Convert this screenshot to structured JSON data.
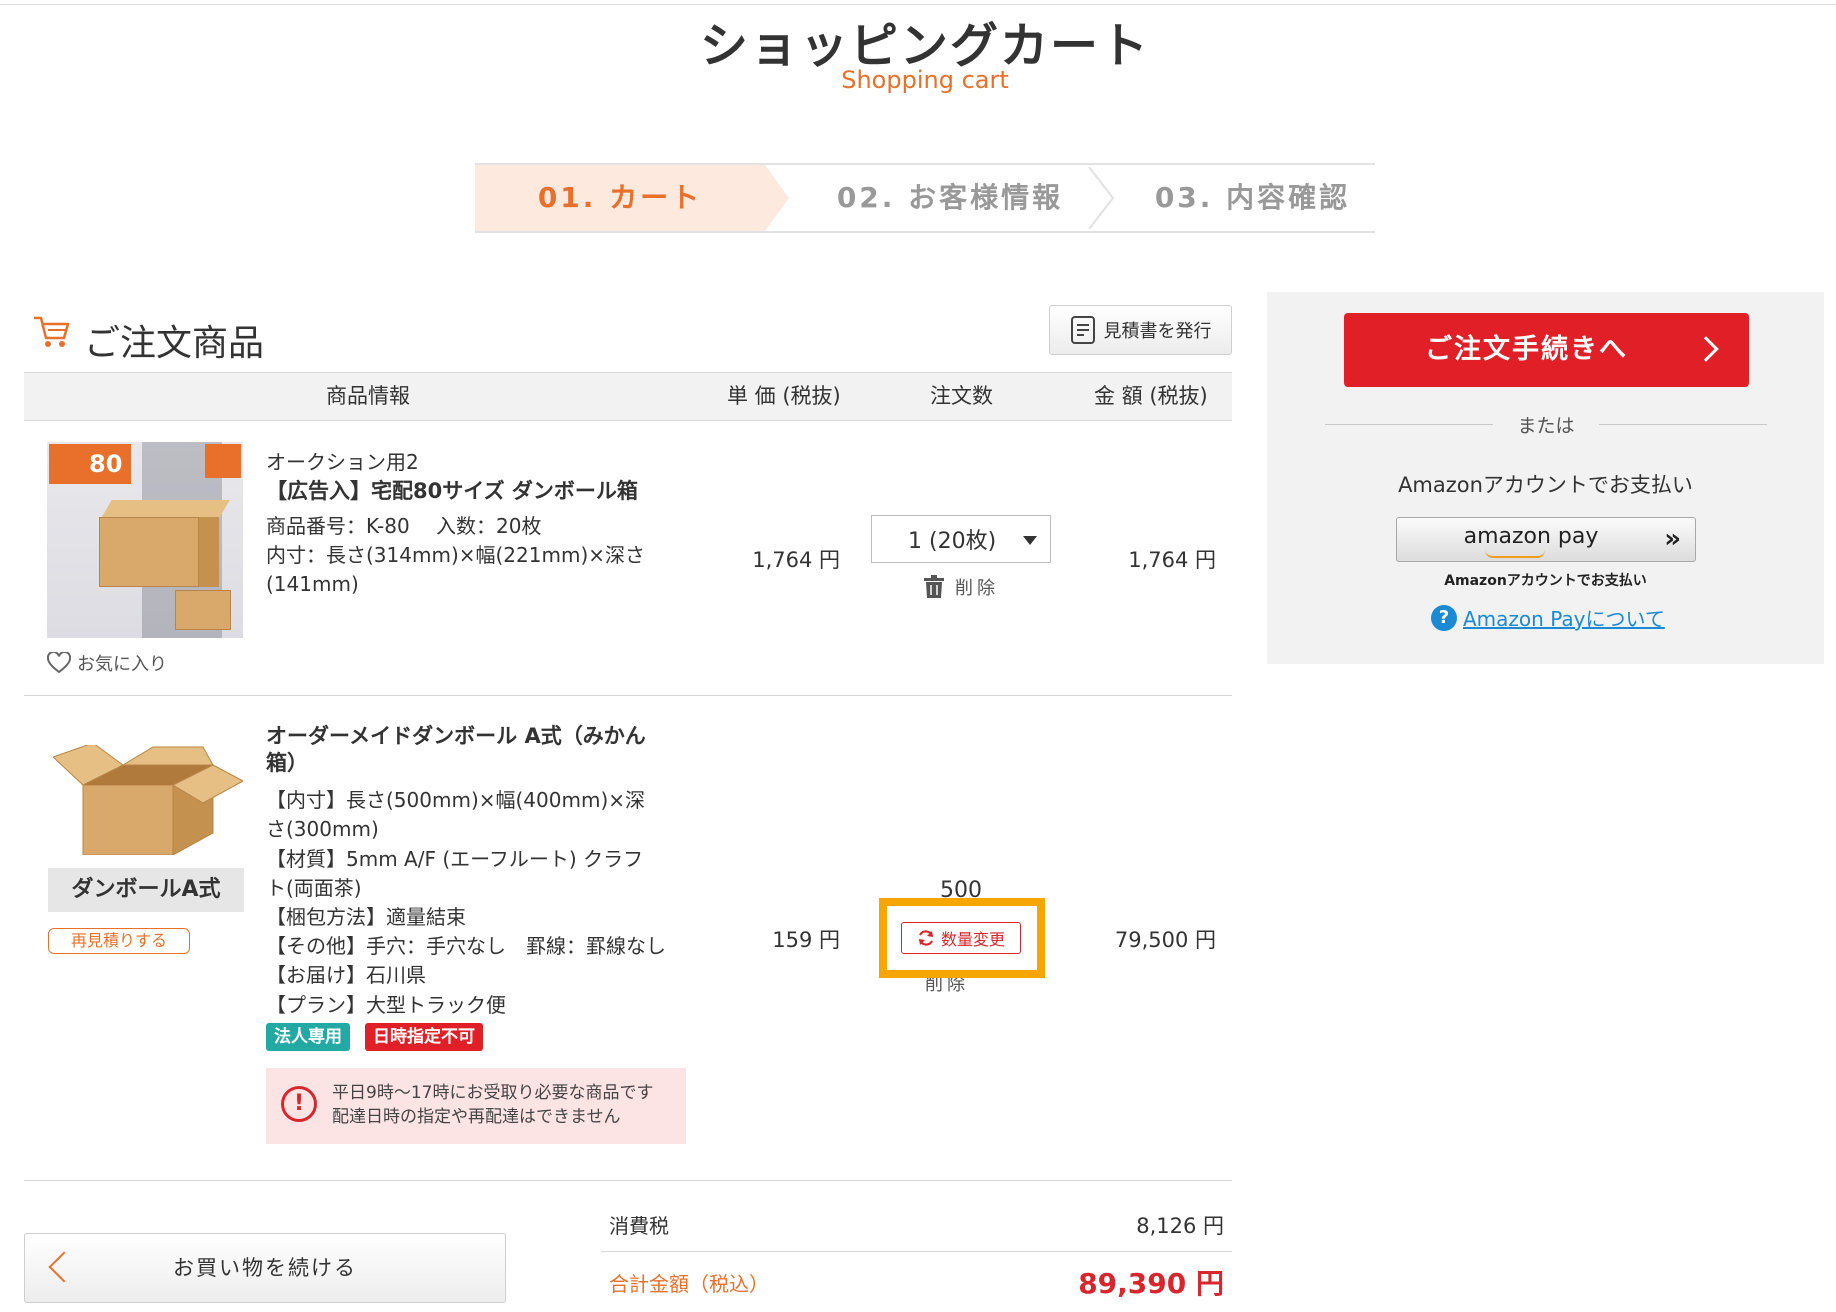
{
  "header": {
    "title": "ショッピングカート",
    "subtitle": "Shopping cart"
  },
  "steps": [
    {
      "label": "01. カート",
      "active": true
    },
    {
      "label": "02. お客様情報",
      "active": false
    },
    {
      "label": "03. 内容確認",
      "active": false
    }
  ],
  "order": {
    "section_title": "ご注文商品",
    "estimate_button": "見積書を発行",
    "columns": [
      "商品情報",
      "単 価 (税抜)",
      "注文数",
      "金 額 (税抜)"
    ]
  },
  "items": [
    {
      "image_badge": "80",
      "category": "オークション用2",
      "name": "【広告入】宅配80サイズ ダンボール箱",
      "details": [
        "商品番号：K-80　 入数：20枚",
        "内寸：長さ(314mm)×幅(221mm)×深さ",
        "(141mm)"
      ],
      "favorite": "お気に入り",
      "unit_price": "1,764 円",
      "quantity": "1 (20枚)",
      "delete": "削除",
      "amount": "1,764 円"
    },
    {
      "image_label": "ダンボールA式",
      "reestimate": "再見積りする",
      "name_line1": "オーダーメイドダンボール A式（みかん",
      "name_line2": "箱）",
      "details": [
        "【内寸】長さ(500mm)×幅(400mm)×深",
        "さ(300mm)",
        "【材質】5mm A/F (エーフルート) クラフ",
        "ト(両面茶)",
        "【梱包方法】適量結束",
        "【その他】手穴：手穴なし　罫線：罫線なし",
        "【お届け】石川県",
        "【プラン】大型トラック便"
      ],
      "tags": [
        {
          "label": "法人専用",
          "color": "#23a9a3"
        },
        {
          "label": "日時指定不可",
          "color": "#e01f26"
        }
      ],
      "notice": [
        "平日9時～17時にお受取り必要な商品です",
        "配達日時の指定や再配達はできません"
      ],
      "unit_price": "159 円",
      "quantity": "500",
      "quantity_change": "数量変更",
      "delete": "削除",
      "amount": "79,500 円"
    }
  ],
  "totals": {
    "tax_label": "消費税",
    "tax_value": "8,126 円",
    "total_label": "合計金額（税込）",
    "total_value": "89,390 円"
  },
  "continue_button": "お買い物を続ける",
  "sidebar": {
    "order_button": "ご注文手続きへ",
    "or_text": "または",
    "amazon_account_text": "Amazonアカウントでお支払い",
    "amazon_pay_logo": "amazon pay",
    "amazon_sub_text": "Amazonアカウントでお支払い",
    "help_link": "Amazon Payについて"
  },
  "colors": {
    "accent": "#e8702a",
    "primary_red": "#e01f26",
    "highlight": "#f7a600",
    "link": "#1a8ad4"
  }
}
